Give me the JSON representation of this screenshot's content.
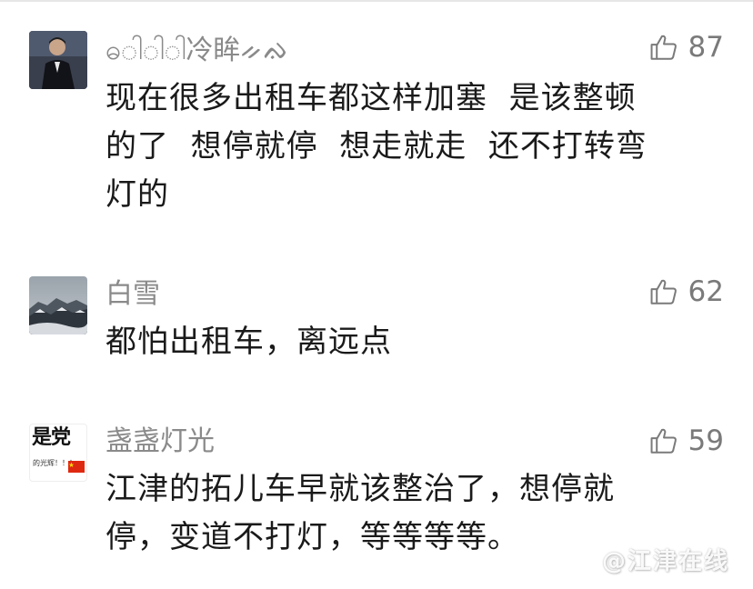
{
  "comments": [
    {
      "username": "ဓ◌ါ◌ါ◌ါ冷眸ᨀᨁ",
      "likes": "87",
      "lines": [
        "现在很多出租车都这样加塞  是该整顿",
        "的了  想停就停  想走就走  还不打转弯",
        "灯的"
      ],
      "avatar": "avatar-man-in-dark-coat"
    },
    {
      "username": "白雪",
      "likes": "62",
      "lines": [
        "都怕出租车，离远点"
      ],
      "avatar": "avatar-snowy-mountain"
    },
    {
      "username": "盏盏灯光",
      "likes": "59",
      "lines": [
        "江津的拓儿车早就该整治了，想停就",
        "停，变道不打灯，等等等等。"
      ],
      "avatar": {
        "title": "是党",
        "caption": "的光辉！！！"
      }
    }
  ],
  "watermark": "@江津在线",
  "icons": {
    "like": "thumbs-up-icon"
  },
  "colors": {
    "username": "#8a8a8a",
    "text": "#1a1a1a",
    "likes": "#7a7a7a",
    "background": "#ffffff"
  }
}
